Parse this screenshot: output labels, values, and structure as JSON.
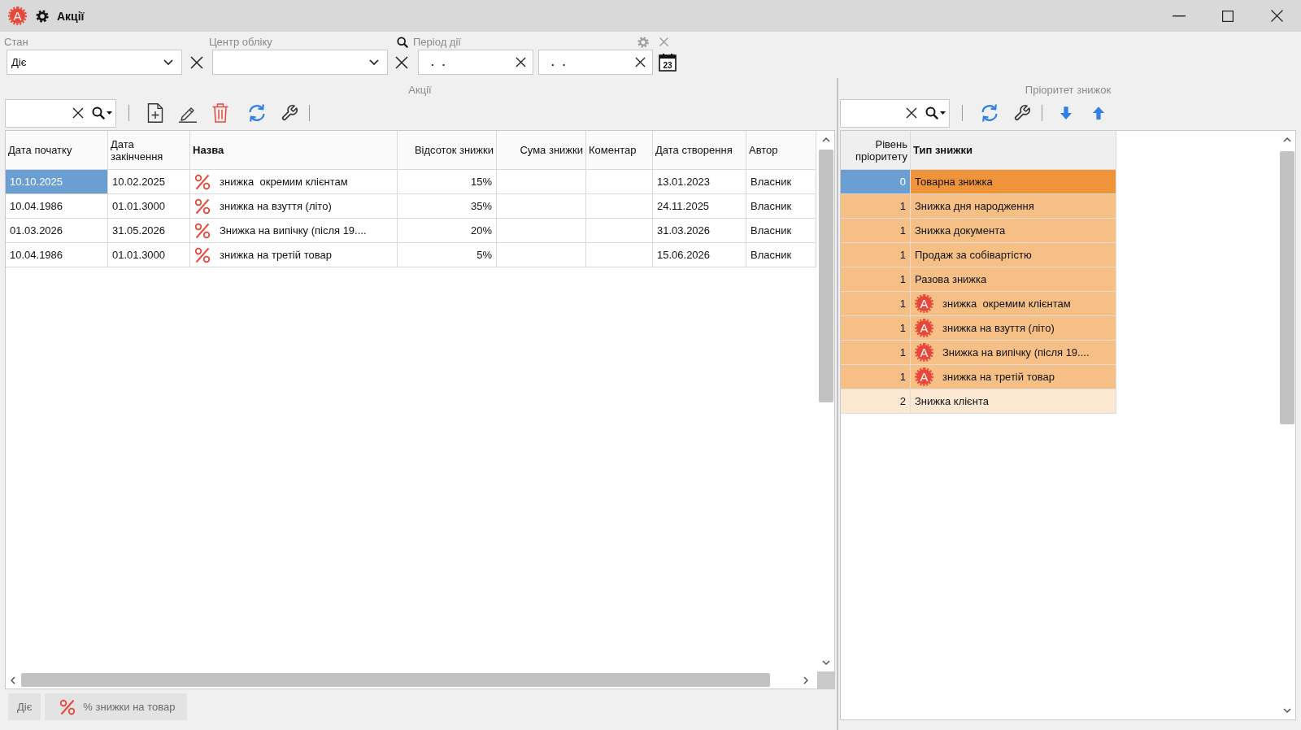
{
  "window": {
    "logo": "A",
    "title": "Акції"
  },
  "filters": {
    "state": {
      "label": "Стан",
      "value": "Діє"
    },
    "accounting_center": {
      "label": "Центр обліку"
    },
    "period": {
      "label": "Період дії",
      "from": ".  .",
      "to": ".  .",
      "calendar_day": "23"
    }
  },
  "promotions": {
    "caption": "Акції",
    "columns": [
      {
        "label": "Дата початку",
        "kind": "text",
        "bold": false
      },
      {
        "label": "Дата закінчення",
        "kind": "text",
        "bold": false
      },
      {
        "label": "Назва",
        "kind": "text",
        "bold": true
      },
      {
        "label": "Відсоток знижки",
        "kind": "number",
        "bold": false
      },
      {
        "label": "Сума знижки",
        "kind": "number",
        "bold": false
      },
      {
        "label": "Коментар",
        "kind": "text",
        "bold": false
      },
      {
        "label": "Дата створення",
        "kind": "text",
        "bold": false
      },
      {
        "label": "Автор",
        "kind": "text",
        "bold": false
      }
    ],
    "rows": [
      {
        "start_date": "10.10.2025",
        "end_date": "10.02.2025",
        "name": "знижка  окремим клієнтам",
        "discount_percent": "15%",
        "created": "13.01.2023",
        "author": "Власник",
        "selected": true
      },
      {
        "start_date": "10.04.1986",
        "end_date": "01.01.3000",
        "name": "знижка на взуття (літо)",
        "discount_percent": "35%",
        "created": "24.11.2025",
        "author": "Власник",
        "selected": false
      },
      {
        "start_date": "01.03.2026",
        "end_date": "31.05.2026",
        "name": "Знижка на випічку (після 19....",
        "discount_percent": "20%",
        "created": "31.03.2026",
        "author": "Власник",
        "selected": false
      },
      {
        "start_date": "10.04.1986",
        "end_date": "01.01.3000",
        "name": "знижка на третій товар",
        "discount_percent": "5%",
        "created": "15.06.2026",
        "author": "Власник",
        "selected": false
      }
    ],
    "status_bar": {
      "state": "Діє",
      "discount_type": "% знижки на товар"
    }
  },
  "priority": {
    "caption": "Пріоритет знижок",
    "columns": [
      {
        "label": "Рівень пріоритету",
        "kind": "number",
        "bold": false
      },
      {
        "label": "Тип знижки",
        "kind": "text",
        "bold": true
      }
    ],
    "rows": [
      {
        "level": "0",
        "name": "Товарна знижка",
        "color": "#f0943c",
        "selected": true
      },
      {
        "level": "1",
        "name": "Знижка дня народження",
        "color": "#f5bf85",
        "selected": false
      },
      {
        "level": "1",
        "name": "Знижка документа",
        "color": "#f5bf85",
        "selected": false
      },
      {
        "level": "1",
        "name": "Продаж за собівартістю",
        "color": "#f5bf85",
        "selected": false
      },
      {
        "level": "1",
        "name": "Разова знижка",
        "color": "#f5bf85",
        "selected": false
      },
      {
        "level": "1",
        "badge": "A",
        "name": "знижка  окремим клієнтам",
        "color": "#f5bf85",
        "selected": false
      },
      {
        "level": "1",
        "badge": "A",
        "name": "знижка на взуття (літо)",
        "color": "#f5bf85",
        "selected": false
      },
      {
        "level": "1",
        "badge": "A",
        "name": "Знижка на випічку (після 19....",
        "color": "#f5bf85",
        "selected": false
      },
      {
        "level": "1",
        "badge": "A",
        "name": "знижка на третій товар",
        "color": "#f5bf85",
        "selected": false
      },
      {
        "level": "2",
        "name": "Знижка клієнта",
        "color": "#fce8d3",
        "selected": false
      }
    ]
  }
}
